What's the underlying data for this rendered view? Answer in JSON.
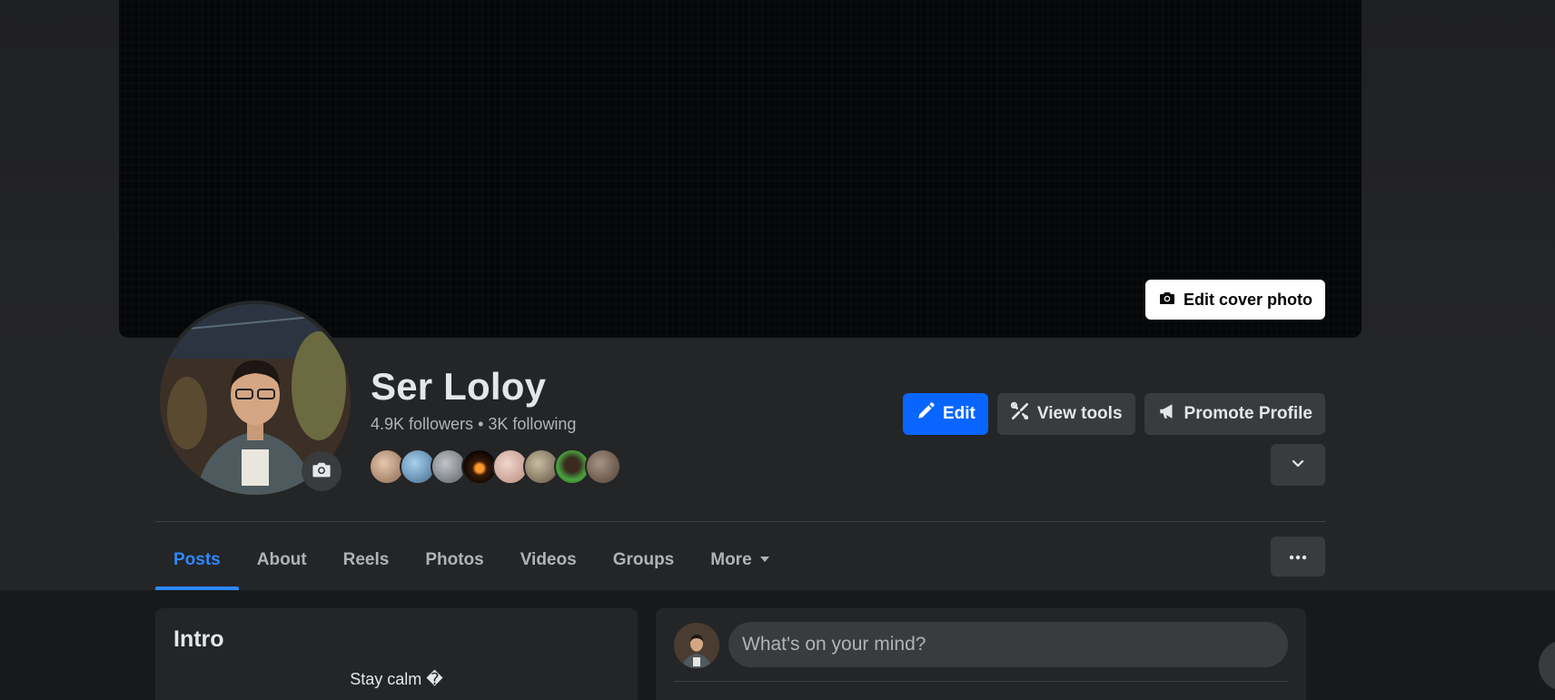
{
  "cover": {
    "edit_cover_label": "Edit cover photo"
  },
  "profile": {
    "name": "Ser Loloy",
    "followers": "4.9K followers",
    "separator": " • ",
    "following": "3K following",
    "friend_avatar_colors": [
      "#c9a58a",
      "#6e9fc4",
      "#8d9095",
      "#1a0f08",
      "#d9b7a8",
      "#9a8c76",
      "#5f8f4a",
      "#7a6a5c"
    ]
  },
  "actions": {
    "edit_label": "Edit",
    "view_tools_label": "View tools",
    "promote_label": "Promote Profile"
  },
  "tabs": [
    {
      "label": "Posts",
      "active": true
    },
    {
      "label": "About"
    },
    {
      "label": "Reels"
    },
    {
      "label": "Photos"
    },
    {
      "label": "Videos"
    },
    {
      "label": "Groups"
    },
    {
      "label": "More"
    }
  ],
  "intro": {
    "title": "Intro",
    "bio": "Stay calm �"
  },
  "composer": {
    "placeholder": "What's on your mind?"
  },
  "colors": {
    "accent": "#0866ff",
    "active_tab": "#2d88ff",
    "background": "#18191a",
    "card": "#242526"
  }
}
